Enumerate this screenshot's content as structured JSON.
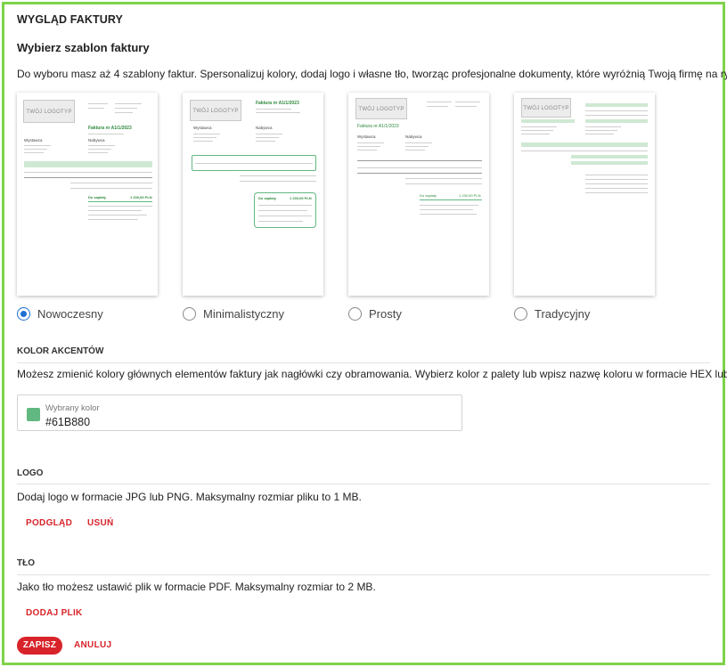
{
  "page": {
    "title": "WYGLĄD FAKTURY",
    "subtitle": "Wybierz szablon faktury",
    "description": "Do wyboru masz aż 4 szablony faktur. Spersonalizuj kolory, dodaj logo i własne tło, tworząc profesjonalne dokumenty, które wyróżnią Twoją firmę na rynku."
  },
  "templates": [
    {
      "label": "Nowoczesny",
      "selected": true
    },
    {
      "label": "Minimalistyczny",
      "selected": false
    },
    {
      "label": "Prosty",
      "selected": false
    },
    {
      "label": "Tradycyjny",
      "selected": false
    }
  ],
  "thumbnail_text": {
    "logo": "TWÓJ LOGOTYP",
    "invoice_title": "Faktura nr A1/1/2023",
    "seller": "Wystawca",
    "buyer": "Nabywca",
    "to_pay": "Do zapłaty",
    "to_pay_amount": "1 230,00 PLN"
  },
  "accent": {
    "heading": "KOLOR AKCENTÓW",
    "description": "Możesz zmienić kolory głównych elementów faktury jak nagłówki czy obramowania. Wybierz kolor z palety lub wpisz nazwę koloru w formacie HEX lub RGB.",
    "field_label": "Wybrany kolor",
    "field_value": "#61B880",
    "color": "#61B880"
  },
  "logo": {
    "heading": "LOGO",
    "description": "Dodaj logo w formacie JPG lub PNG. Maksymalny rozmiar pliku to 1 MB.",
    "preview_label": "PODGLĄD",
    "remove_label": "USUŃ"
  },
  "background": {
    "heading": "TŁO",
    "description": "Jako tło możesz ustawić plik w formacie PDF. Maksymalny rozmiar to 2 MB.",
    "add_file_label": "DODAJ PLIK"
  },
  "actions": {
    "save_label": "ZAPISZ",
    "cancel_label": "ANULUJ"
  },
  "colors": {
    "brand_red": "#d8232a",
    "border_green": "#7fd24a",
    "radio_blue": "#1f6fd1"
  }
}
